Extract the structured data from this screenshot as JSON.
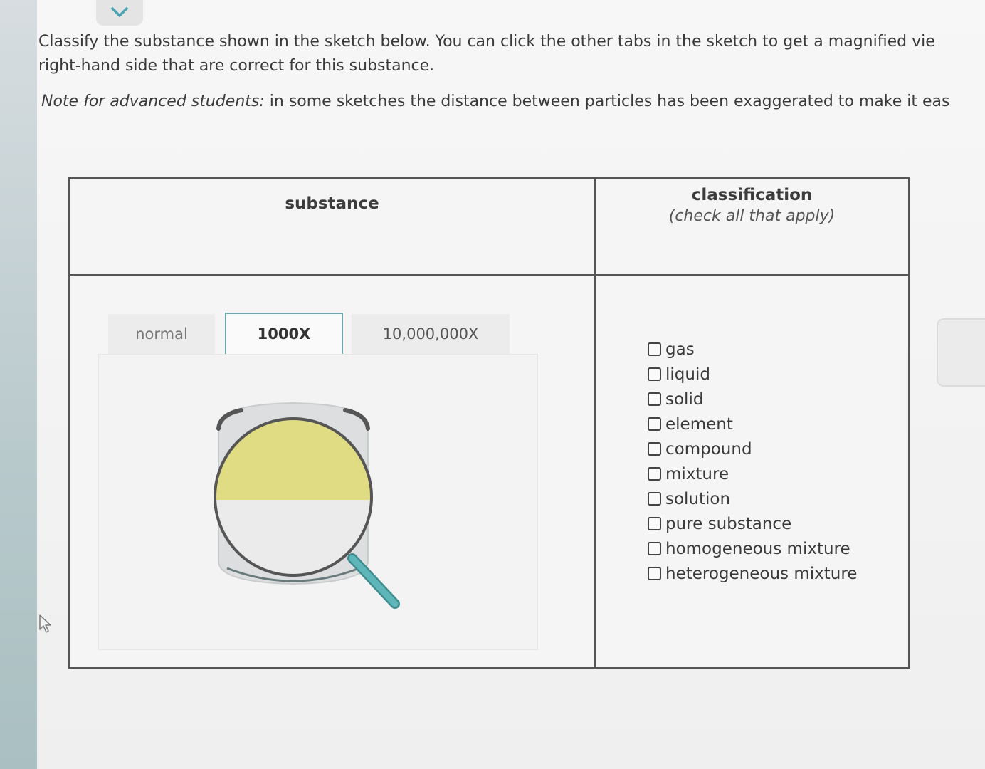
{
  "prompt": {
    "line1": "Classify the substance shown in the sketch below. You can click the other tabs in the sketch to get a magnified vie",
    "line2": "right-hand side that are correct for this substance."
  },
  "note": {
    "label": "Note for advanced students:",
    "text": " in some sketches the distance between particles has been exaggerated to make it eas"
  },
  "table": {
    "substance_header": "substance",
    "classification_header": "classification",
    "classification_sub": "(check all that apply)"
  },
  "tabs": [
    {
      "label": "normal",
      "selected": false
    },
    {
      "label": "1000X",
      "selected": true
    },
    {
      "label": "10,000,000X",
      "selected": false
    }
  ],
  "options": [
    {
      "label": "gas",
      "checked": false
    },
    {
      "label": "liquid",
      "checked": false
    },
    {
      "label": "solid",
      "checked": false
    },
    {
      "label": "element",
      "checked": false
    },
    {
      "label": "compound",
      "checked": false
    },
    {
      "label": "mixture",
      "checked": false
    },
    {
      "label": "solution",
      "checked": false
    },
    {
      "label": "pure substance",
      "checked": false
    },
    {
      "label": "homogeneous mixture",
      "checked": false
    },
    {
      "label": "heterogeneous mixture",
      "checked": false
    }
  ],
  "colors": {
    "accent": "#4aa3b0",
    "yellow_layer": "#e0dc84",
    "white_layer": "#ebebeb",
    "magnifier_handle": "#5fb6b8"
  },
  "icons": [
    "chevron-down-icon",
    "magnifier-icon",
    "mouse-cursor-icon"
  ]
}
